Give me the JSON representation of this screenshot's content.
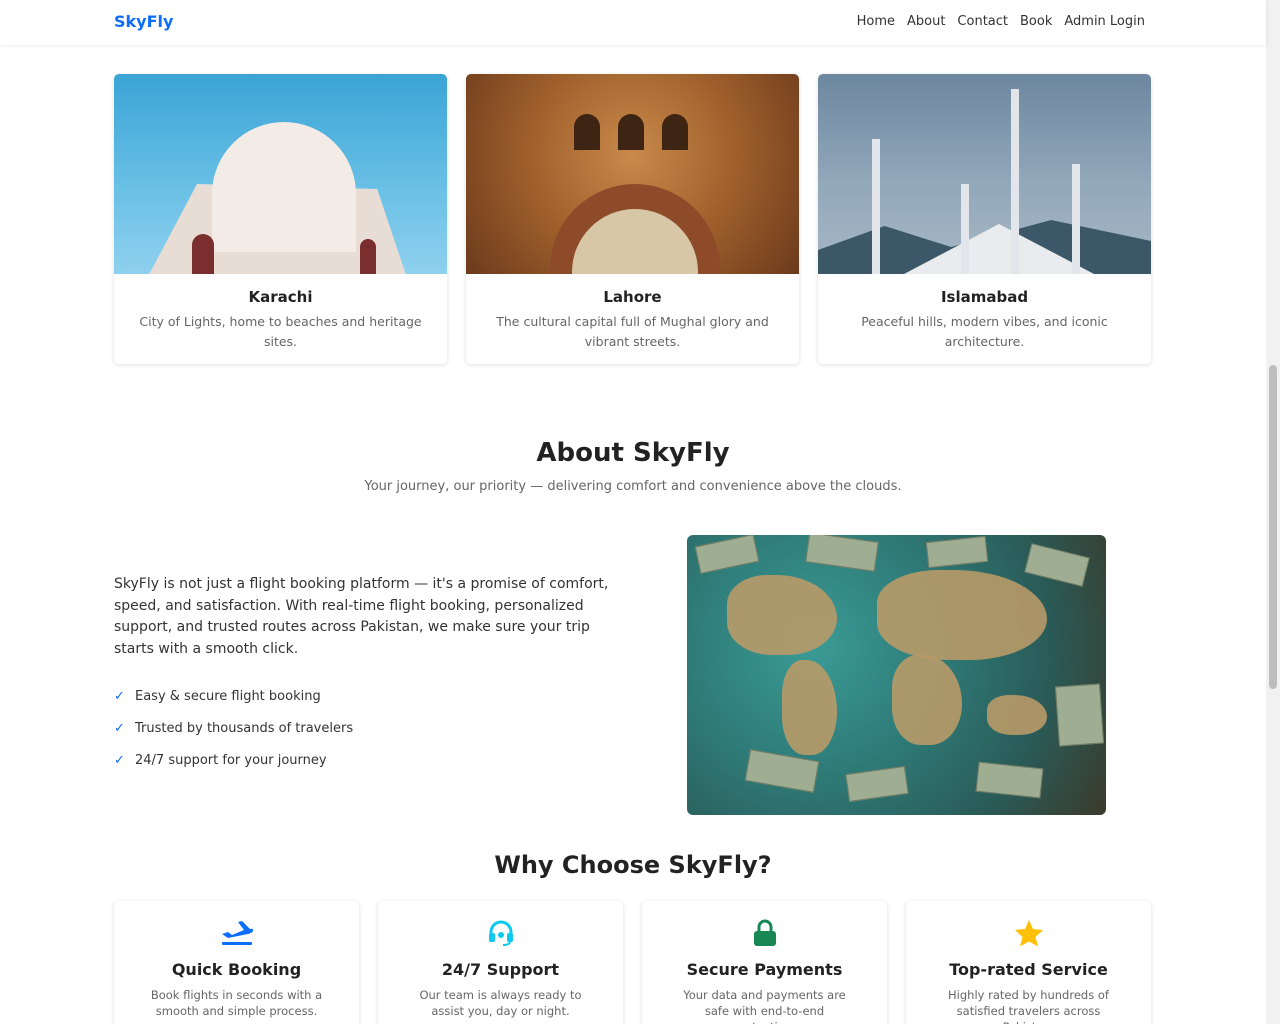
{
  "navbar": {
    "brand": "SkyFly",
    "links": [
      "Home",
      "About",
      "Contact",
      "Book",
      "Admin Login"
    ]
  },
  "cities": [
    {
      "name": "Karachi",
      "description": "City of Lights, home to beaches and heritage sites."
    },
    {
      "name": "Lahore",
      "description": "The cultural capital full of Mughal glory and vibrant streets."
    },
    {
      "name": "Islamabad",
      "description": "Peaceful hills, modern vibes, and iconic architecture."
    }
  ],
  "about": {
    "title": "About SkyFly",
    "subtitle": "Your journey, our priority — delivering comfort and convenience above the clouds.",
    "text": "SkyFly is not just a flight booking platform — it's a promise of comfort, speed, and satisfaction. With real-time flight booking, personalized support, and trusted routes across Pakistan, we make sure your trip starts with a smooth click.",
    "points": [
      "Easy & secure flight booking",
      "Trusted by thousands of travelers",
      "24/7 support for your journey"
    ]
  },
  "why": {
    "title": "Why Choose SkyFly?",
    "features": [
      {
        "icon": "plane-icon",
        "title": "Quick Booking",
        "description": "Book flights in seconds with a smooth and simple process."
      },
      {
        "icon": "headset-icon",
        "title": "24/7 Support",
        "description": "Our team is always ready to assist you, day or night."
      },
      {
        "icon": "lock-icon",
        "title": "Secure Payments",
        "description": "Your data and payments are safe with end-to-end protection."
      },
      {
        "icon": "star-icon",
        "title": "Top-rated Service",
        "description": "Highly rated by hundreds of satisfied travelers across Pakistan."
      }
    ]
  },
  "colors": {
    "accent": "#0d6efd",
    "support": "#0dcaf0",
    "secure": "#198754",
    "star": "#ffc107"
  }
}
